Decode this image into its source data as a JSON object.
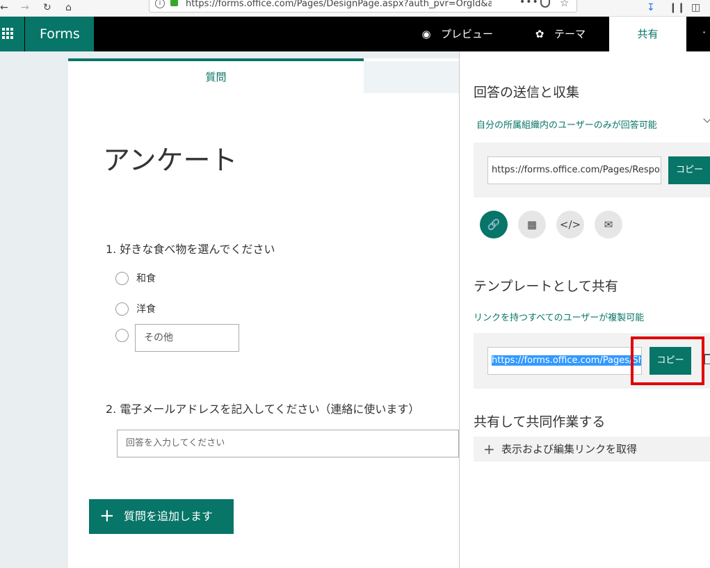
{
  "browser": {
    "url": "https://forms.office.com/Pages/DesignPage.aspx?auth_pvr=OrgId&auth_",
    "more": "•••"
  },
  "appbar": {
    "brand": "Forms",
    "preview": "プレビュー",
    "theme": "テーマ",
    "share": "共有"
  },
  "form": {
    "tab_question": "質問",
    "title": "アンケート",
    "q1": {
      "text": "1. 好きな食べ物を選んでください",
      "options": [
        "和食",
        "洋食"
      ],
      "other_placeholder": "その他"
    },
    "q2": {
      "text": "2. 電子メールアドレスを記入してください（連絡に使います）",
      "placeholder": "回答を入力してください"
    },
    "add_question": "質問を追加します"
  },
  "share_panel": {
    "send_heading": "回答の送信と収集",
    "audience": "自分の所属組織内のユーザーのみが回答可能",
    "response_url": "https://forms.office.com/Pages/ResponsePage.aspx",
    "copy_label": "コピー",
    "template_heading": "テンプレートとして共有",
    "template_audience": "リンクを持つすべてのユーザーが複製可能",
    "template_url": "https://forms.office.com/Pages/ShareFormPage.aspx",
    "collab_heading": "共有して共同作業する",
    "collab_action": "表示および編集リンクを取得",
    "share_icons": [
      "link-icon",
      "qr-code-icon",
      "embed-icon",
      "email-icon"
    ]
  },
  "colors": {
    "accent": "#077568",
    "highlight": "#e00000"
  }
}
